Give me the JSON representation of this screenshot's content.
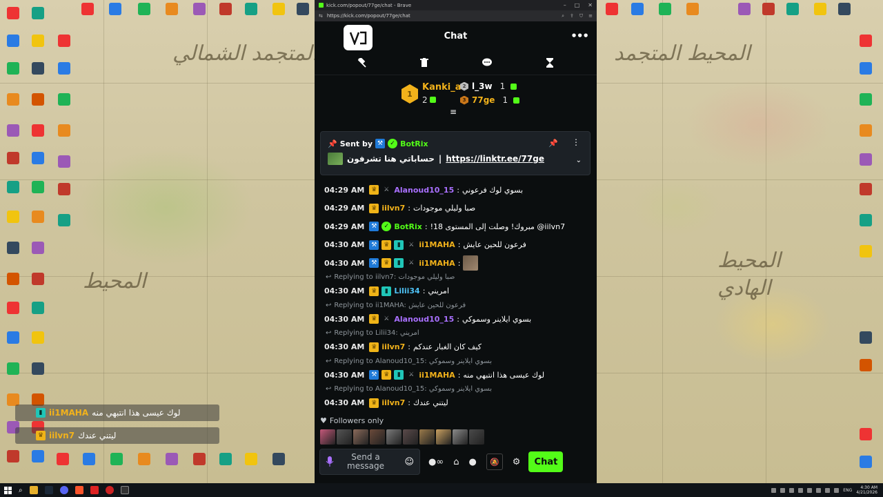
{
  "browser": {
    "title": "kick.com/popout/77ge/chat - Brave",
    "url": "https://kick.com/popout/77ge/chat"
  },
  "chat": {
    "title": "Chat",
    "leaderboard": {
      "first": {
        "rank": "1",
        "name": "Kanki_a",
        "count": "2",
        "color": "#f2b21b"
      },
      "second": {
        "rank": "2",
        "name": "l_3w",
        "count": "1",
        "color": "#ffffff"
      },
      "third": {
        "rank": "3",
        "name": "77ge",
        "count": "1",
        "color": "#f2b21b"
      }
    },
    "pinned": {
      "sent_by": "Sent by",
      "author": "BotRix",
      "text": "حساباتي هنا تشرفون",
      "separator": "|",
      "link": "https://linktr.ee/77ge"
    },
    "messages": [
      {
        "type": "msg",
        "time": "04:29 AM",
        "name": "Alanoud10_15",
        "color": "#a970ff",
        "text": "بسوي لوك فرعوني"
      },
      {
        "type": "msg",
        "time": "04:29 AM",
        "name": "iilvn7",
        "color": "#f2b21b",
        "text": "صبا وليلي موجودات"
      },
      {
        "type": "msg",
        "time": "04:29 AM",
        "name": "BotRix",
        "color": "#53fc18",
        "text": "!مبروك! وصلت إلى المستوى 18 @iilvn7"
      },
      {
        "type": "msg",
        "time": "04:30 AM",
        "name": "ii1MAHA",
        "color": "#f2b21b",
        "text": "فرعون للحين عايش"
      },
      {
        "type": "msg",
        "time": "04:30 AM",
        "name": "ii1MAHA",
        "color": "#f2b21b",
        "text": ""
      },
      {
        "type": "reply",
        "text": "Replying to iilvn7: صبا وليلي موجودات"
      },
      {
        "type": "msg",
        "time": "04:30 AM",
        "name": "Lilii34",
        "color": "#4fc3f7",
        "text": "امريني"
      },
      {
        "type": "reply",
        "text": "Replying to ii1MAHA: فرعون للحين عايش"
      },
      {
        "type": "msg",
        "time": "04:30 AM",
        "name": "Alanoud10_15",
        "color": "#a970ff",
        "text": "بسوي ايلاينر وسموكي"
      },
      {
        "type": "reply",
        "text": "Replying to Lilii34: امريني"
      },
      {
        "type": "msg",
        "time": "04:30 AM",
        "name": "iilvn7",
        "color": "#f2b21b",
        "text": "كيف كان الغبار عندكم"
      },
      {
        "type": "reply",
        "text": "Replying to Alanoud10_15: بسوي ايلاينر وسموكي"
      },
      {
        "type": "msg",
        "time": "04:30 AM",
        "name": "ii1MAHA",
        "color": "#f2b21b",
        "text": "لوك عيسى هذا انتبهي منه"
      },
      {
        "type": "reply",
        "text": "Replying to Alanoud10_15: بسوي ايلاينر وسموكي"
      },
      {
        "type": "msg",
        "time": "04:30 AM",
        "name": "iilvn7",
        "color": "#f2b21b",
        "text": "ليتني عندك"
      }
    ],
    "followers_only": "Followers only",
    "composer": {
      "placeholder": "Send a message",
      "send_label": "Chat"
    }
  },
  "overlay": [
    {
      "name": "ii1MAHA",
      "text": "لوك عيسى هذا انتبهي منه"
    },
    {
      "name": "iilvn7",
      "text": "ليتني عندك"
    }
  ],
  "taskbar": {
    "lang": "ENG",
    "time": "4:30 AM",
    "date": "4/21/2026"
  },
  "colors": {
    "accent": "#53fc18",
    "background": "#0b0e0f",
    "panel": "#1c2126"
  }
}
